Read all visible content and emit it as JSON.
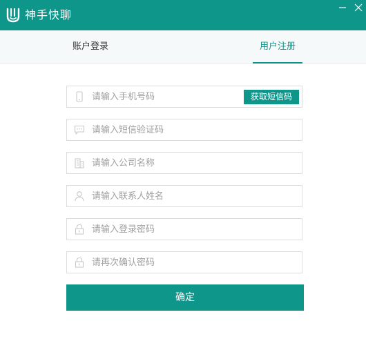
{
  "window": {
    "title": "神手快聊",
    "accent_color": "#0e968b",
    "logo_icon": "hand-logo-icon",
    "controls": [
      "minimize-icon",
      "close-icon"
    ]
  },
  "tabs": {
    "login_label": "账户登录",
    "register_label": "用户注册",
    "active": "register"
  },
  "form": {
    "phone_placeholder": "请输入手机号码",
    "phone_value": "",
    "sms_button_label": "获取短信码",
    "sms_code_placeholder": "请输入短信验证码",
    "sms_code_value": "",
    "company_placeholder": "请输入公司名称",
    "company_value": "",
    "contact_placeholder": "请输入联系人姓名",
    "contact_value": "",
    "password_placeholder": "请输入登录密码",
    "password_value": "",
    "confirm_password_placeholder": "请再次确认密码",
    "confirm_password_value": "",
    "submit_label": "确定"
  }
}
